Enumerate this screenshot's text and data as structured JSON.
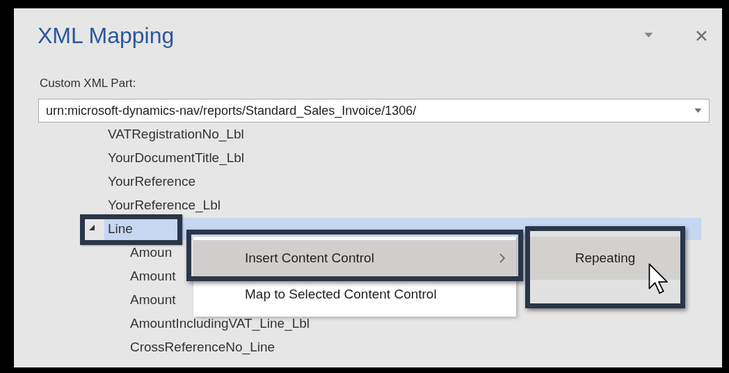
{
  "pane": {
    "title": "XML Mapping"
  },
  "custom_xml_part": {
    "label": "Custom XML Part:",
    "value": "urn:microsoft-dynamics-nav/reports/Standard_Sales_Invoice/1306/"
  },
  "tree": [
    {
      "label": "VATRegistrationNo_Lbl",
      "selected": false
    },
    {
      "label": "YourDocumentTitle_Lbl",
      "selected": false
    },
    {
      "label": "YourReference",
      "selected": false
    },
    {
      "label": "YourReference_Lbl",
      "selected": false
    },
    {
      "label": "Line",
      "selected": true,
      "expanded": true,
      "callout": true,
      "children": [
        {
          "label": "Amoun",
          "selected": false
        },
        {
          "label": "Amount",
          "selected": false
        },
        {
          "label": "Amount",
          "selected": false
        },
        {
          "label": "AmountIncludingVAT_Line_Lbl",
          "selected": false
        },
        {
          "label": "CrossReferenceNo_Line",
          "selected": false
        }
      ]
    }
  ],
  "context_menu": [
    {
      "label": "Insert Content Control",
      "highlighted": true,
      "submenu": true,
      "callout": true
    },
    {
      "label": "Map to Selected Content Control",
      "highlighted": false,
      "submenu": false,
      "callout": false
    }
  ],
  "submenu": [
    {
      "label": "Repeating",
      "highlighted": true,
      "callout": true
    }
  ]
}
